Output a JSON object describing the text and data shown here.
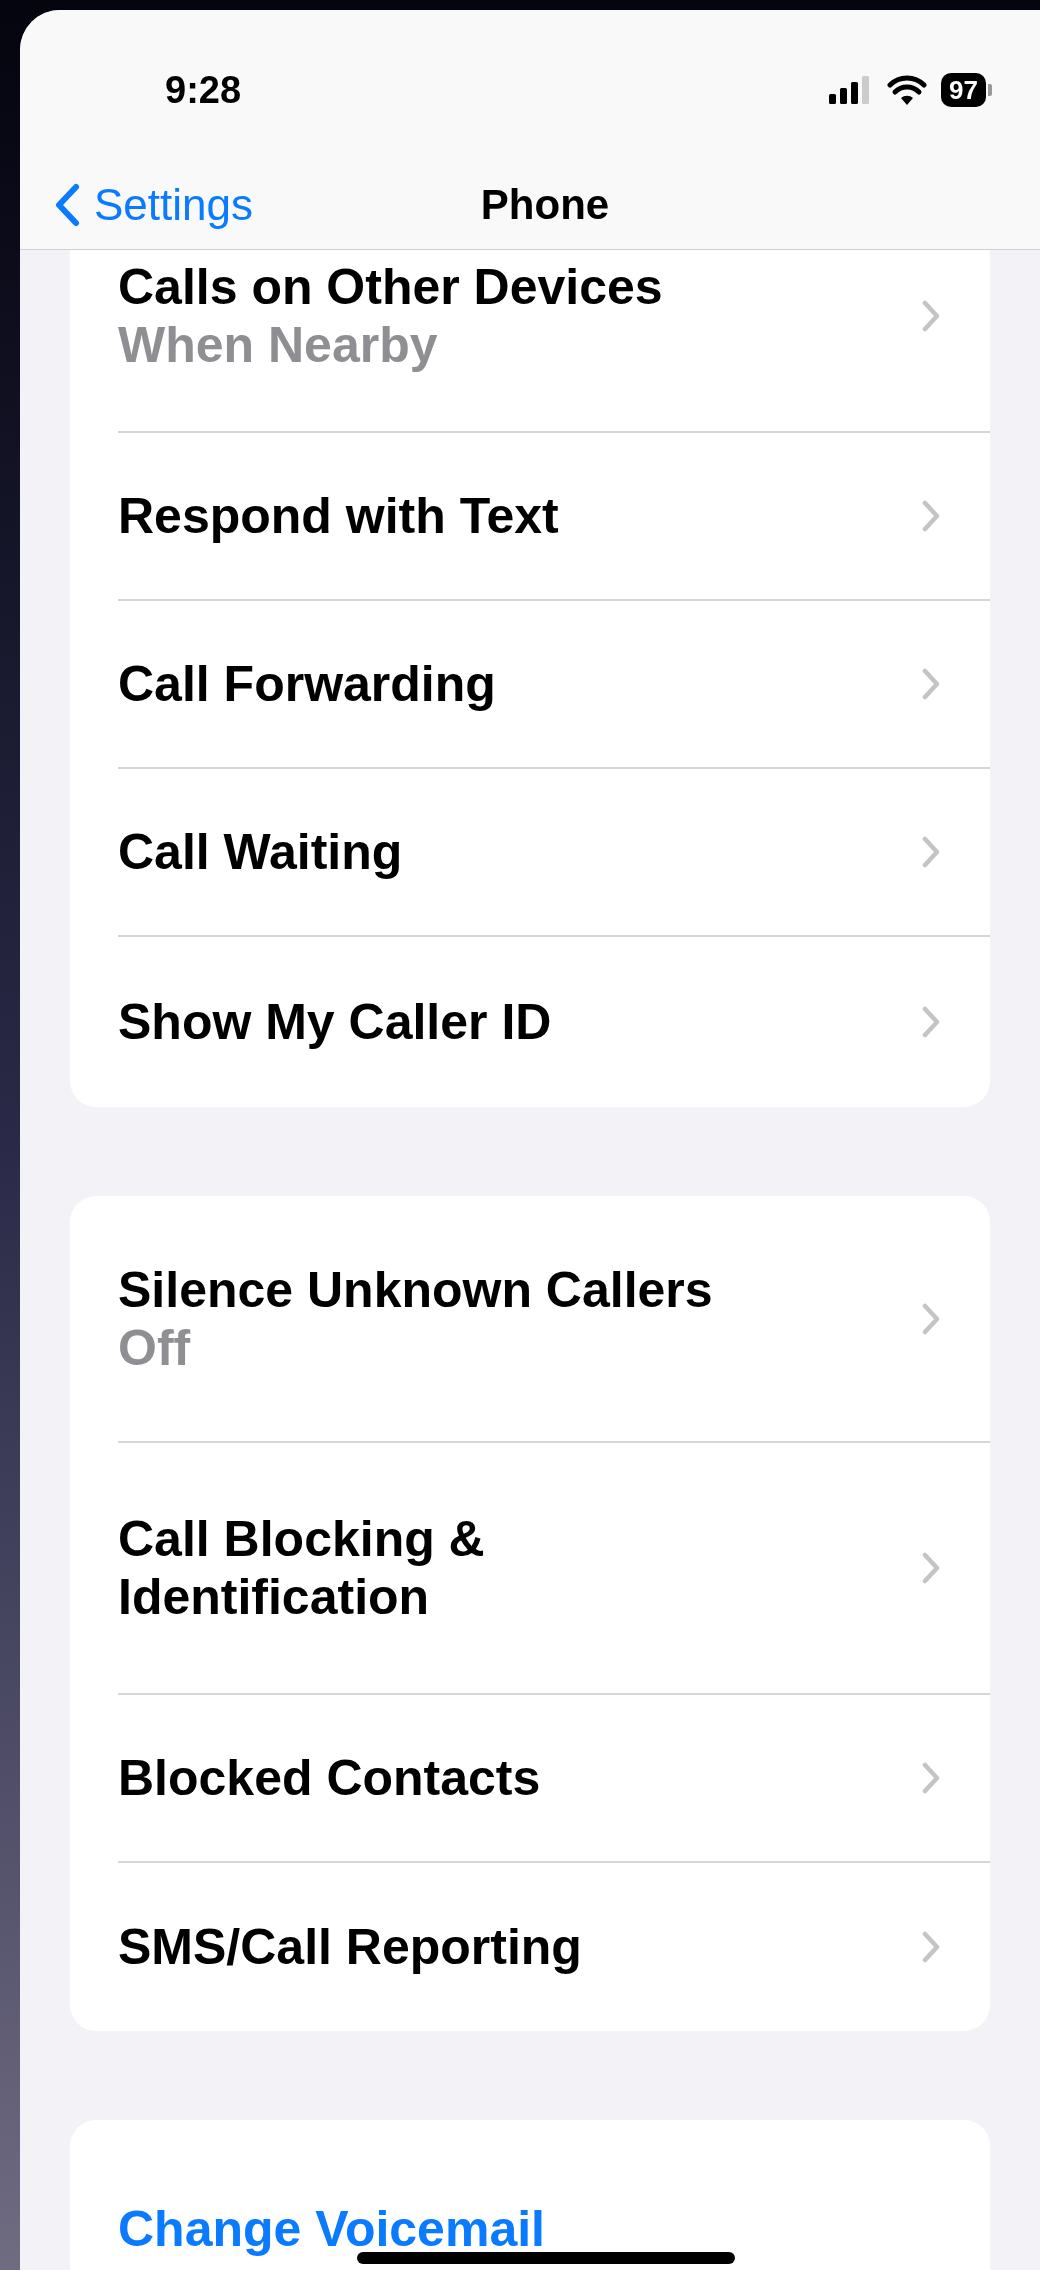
{
  "status_bar": {
    "time": "9:28",
    "battery": "97"
  },
  "nav_bar": {
    "back_label": "Settings",
    "title": "Phone"
  },
  "groups": [
    {
      "rows": [
        {
          "kind": "link",
          "title": "Calls on Other Devices",
          "subtitle": "When Nearby"
        },
        {
          "kind": "link",
          "title": "Respond with Text"
        },
        {
          "kind": "link",
          "title": "Call Forwarding"
        },
        {
          "kind": "link",
          "title": "Call Waiting"
        },
        {
          "kind": "link",
          "title": "Show My Caller ID"
        }
      ]
    },
    {
      "rows": [
        {
          "kind": "link",
          "title": "Silence Unknown Callers",
          "subtitle": "Off"
        },
        {
          "kind": "link",
          "title": "Call Blocking &\nIdentification"
        },
        {
          "kind": "link",
          "title": "Blocked Contacts"
        },
        {
          "kind": "link",
          "title": "SMS/Call Reporting"
        }
      ]
    },
    {
      "rows": [
        {
          "kind": "action",
          "title": "Change Voicemail"
        }
      ]
    }
  ]
}
